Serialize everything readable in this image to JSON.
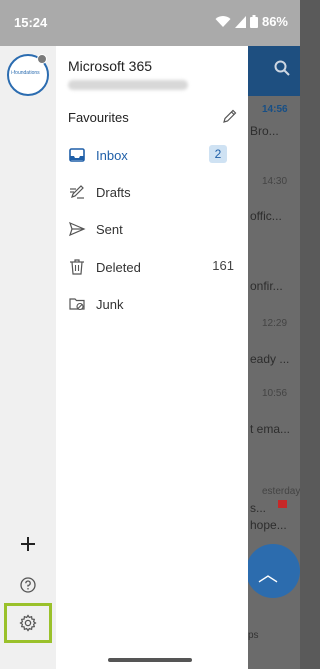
{
  "status_bar": {
    "time": "15:24",
    "battery": "86%"
  },
  "rail": {
    "avatar_text": "i-foundations",
    "add_icon": "plus-icon",
    "help_icon": "help-icon",
    "settings_icon": "gear-icon"
  },
  "drawer": {
    "account_title": "Microsoft 365",
    "favourites_title": "Favourites",
    "folders": [
      {
        "label": "Inbox",
        "icon": "inbox-icon",
        "badge": "2"
      },
      {
        "label": "Drafts",
        "icon": "drafts-icon"
      },
      {
        "label": "Sent",
        "icon": "send-icon"
      },
      {
        "label": "Deleted",
        "icon": "trash-icon",
        "count": "161"
      },
      {
        "label": "Junk",
        "icon": "junk-folder-icon"
      }
    ]
  },
  "background_list": {
    "times": [
      "14:56",
      "14:30",
      "12:29",
      "10:56"
    ],
    "snippets": [
      "Bro...",
      "offic...",
      "onfir...",
      "eady ...",
      "t ema...",
      "esterday",
      "s...",
      "hope..."
    ],
    "bottom_label": "ps"
  },
  "colors": {
    "accent": "#1f5fa8",
    "highlight": "#9ac12b",
    "badge_bg": "#cfe2f3"
  }
}
